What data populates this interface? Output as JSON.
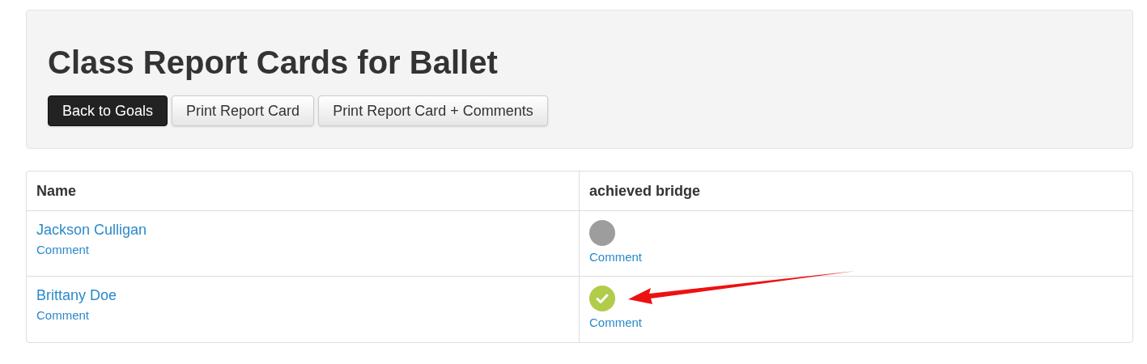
{
  "header": {
    "title": "Class Report Cards for Ballet",
    "buttons": [
      {
        "label": "Back to Goals",
        "kind": "primary"
      },
      {
        "label": "Print Report Card",
        "kind": "default"
      },
      {
        "label": "Print Report Card + Comments",
        "kind": "default"
      }
    ]
  },
  "table": {
    "columns": [
      "Name",
      "achieved bridge"
    ],
    "rows": [
      {
        "name": "Jackson Culligan",
        "name_comment": "Comment",
        "achieved": false,
        "goal_comment": "Comment"
      },
      {
        "name": "Brittany Doe",
        "name_comment": "Comment",
        "achieved": true,
        "goal_comment": "Comment"
      }
    ]
  }
}
